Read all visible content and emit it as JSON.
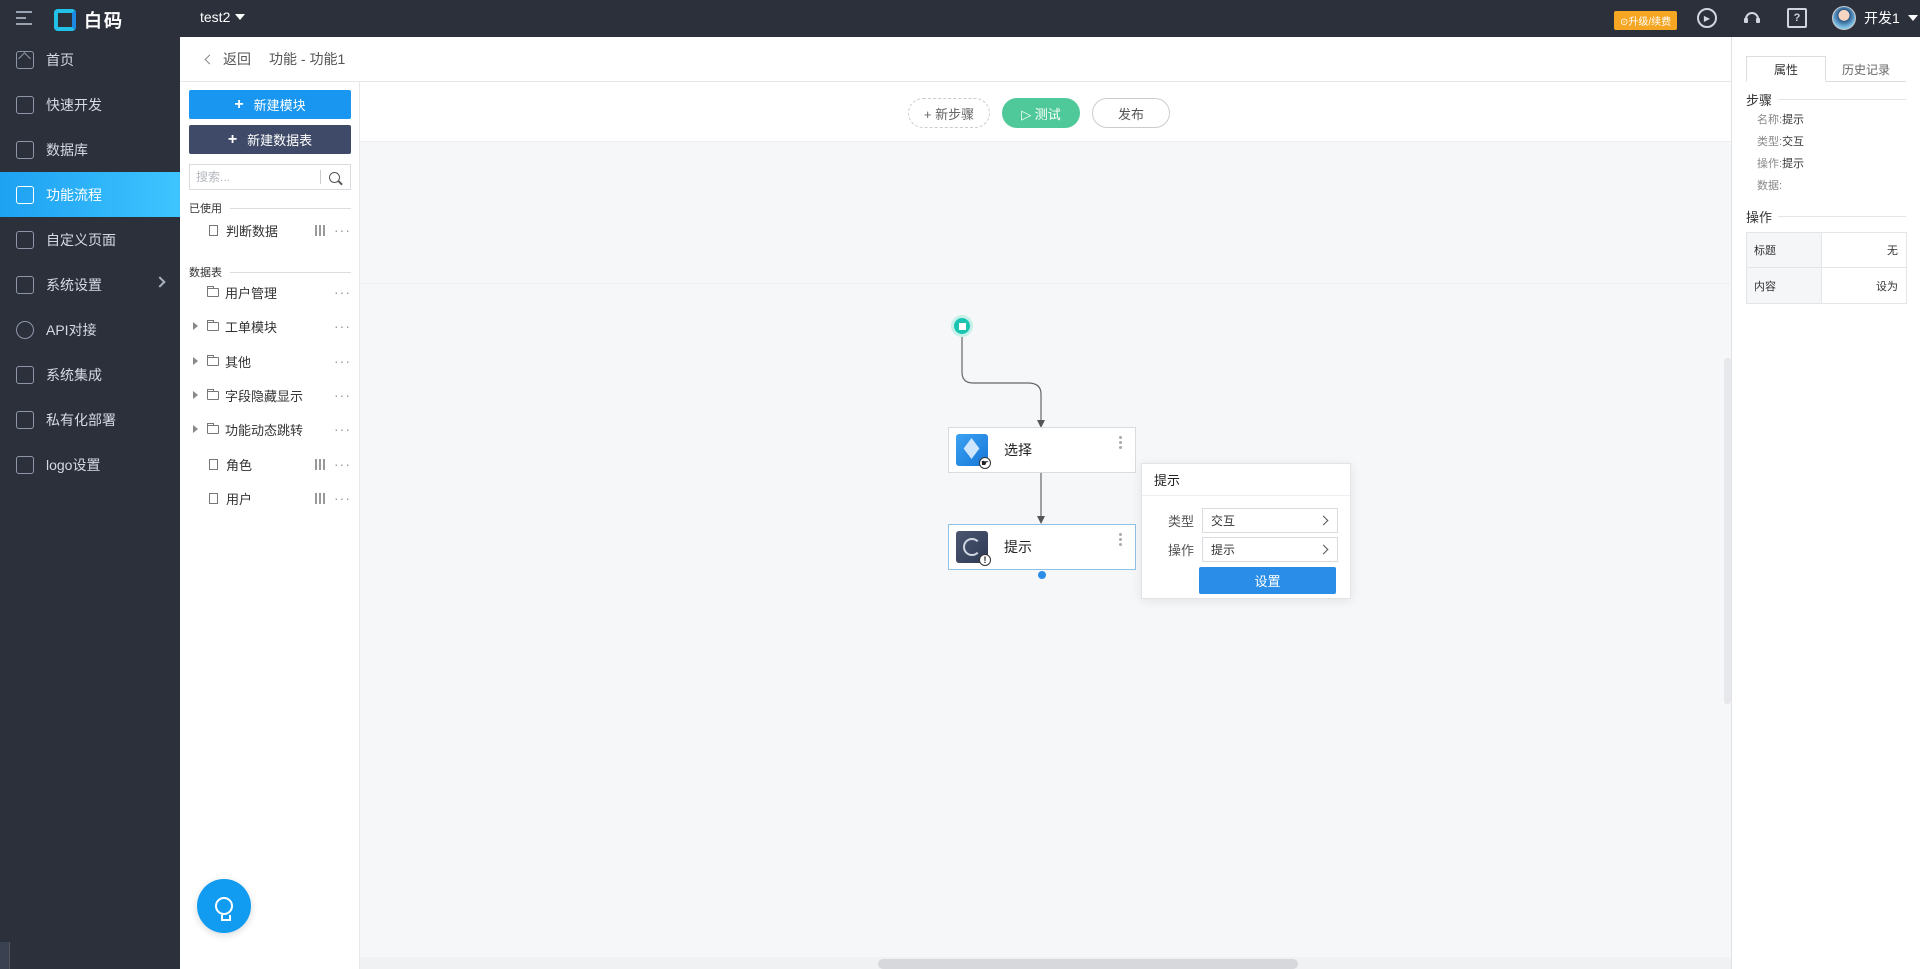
{
  "topbar": {
    "brand": "白码",
    "app_name": "test2",
    "upgrade_label": "⊙升级/续费",
    "user_name": "开发1"
  },
  "sidebar": {
    "items": [
      {
        "label": "首页",
        "icon": "home-icon"
      },
      {
        "label": "快速开发",
        "icon": "cube-icon"
      },
      {
        "label": "数据库",
        "icon": "database-icon"
      },
      {
        "label": "功能流程",
        "icon": "flow-icon",
        "active": true
      },
      {
        "label": "自定义页面",
        "icon": "page-icon"
      },
      {
        "label": "系统设置",
        "icon": "settings-icon",
        "has_children": true
      },
      {
        "label": "API对接",
        "icon": "api-icon"
      },
      {
        "label": "系统集成",
        "icon": "layers-icon"
      },
      {
        "label": "私有化部署",
        "icon": "lock-icon"
      },
      {
        "label": "logo设置",
        "icon": "logo-icon"
      }
    ]
  },
  "breadcrumb": {
    "back": "返回",
    "path": "功能 - 功能1"
  },
  "module_panel": {
    "new_module": "新建模块",
    "new_table": "新建数据表",
    "search_placeholder": "搜索...",
    "used_title": "已使用",
    "used_items": [
      {
        "label": "判断数据",
        "type": "file"
      }
    ],
    "tables_title": "数据表",
    "tables": [
      {
        "label": "用户管理",
        "type": "folder",
        "expandable": false
      },
      {
        "label": "工单模块",
        "type": "folder",
        "expandable": true
      },
      {
        "label": "其他",
        "type": "folder",
        "expandable": true
      },
      {
        "label": "字段隐藏显示",
        "type": "folder",
        "expandable": true
      },
      {
        "label": "功能动态跳转",
        "type": "folder",
        "expandable": true
      },
      {
        "label": "角色",
        "type": "file",
        "expandable": false
      },
      {
        "label": "用户",
        "type": "file",
        "expandable": false
      }
    ]
  },
  "toolbar": {
    "new_step": "+ 新步骤",
    "test": "▷ 测试",
    "publish": "发布"
  },
  "flow": {
    "nodes": [
      {
        "label": "选择",
        "icon": "select-cube-icon"
      },
      {
        "label": "提示",
        "icon": "prompt-icon",
        "selected": true
      }
    ]
  },
  "popover": {
    "title": "提示",
    "type_label": "类型",
    "type_value": "交互",
    "op_label": "操作",
    "op_value": "提示",
    "button": "设置"
  },
  "right_panel": {
    "tabs": [
      "属性",
      "历史记录"
    ],
    "active_tab": 0,
    "step_section": "步骤",
    "props": [
      {
        "k": "名称:",
        "v": "提示"
      },
      {
        "k": "类型:",
        "v": "交互"
      },
      {
        "k": "操作:",
        "v": "提示"
      },
      {
        "k": "数据:",
        "v": ""
      }
    ],
    "op_section": "操作",
    "op_rows": [
      {
        "k": "标题",
        "v": "无"
      },
      {
        "k": "内容",
        "v": "设为"
      }
    ]
  },
  "colors": {
    "accent": "#1896f0",
    "nav_bg": "#2b303b",
    "test_green": "#4fc99a",
    "start_teal": "#19c4b0"
  }
}
